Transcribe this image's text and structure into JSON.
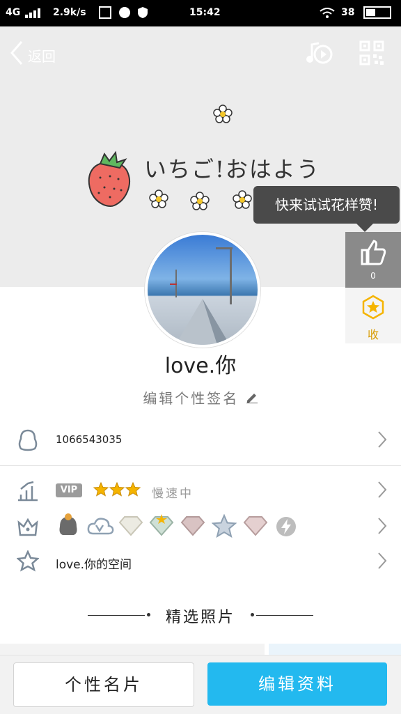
{
  "status_bar": {
    "network": "4G",
    "speed": "2.9k/s",
    "time": "15:42",
    "battery": "38"
  },
  "nav": {
    "back_label": "返回"
  },
  "banner": {
    "text": "いちご!おはよう"
  },
  "tooltip": {
    "text": "快来试试花样赞!"
  },
  "like": {
    "count": "0"
  },
  "collect": {
    "label": "收"
  },
  "profile": {
    "username": "love.你",
    "signature": "编辑个性签名"
  },
  "rows": {
    "qq_number": "1066543035",
    "vip_badge": "VIP",
    "vip_status": "慢速中",
    "space": "love.你的空间"
  },
  "featured": {
    "title": "精选照片"
  },
  "buttons": {
    "card": "个性名片",
    "edit": "编辑资料"
  },
  "colors": {
    "accent": "#23b9ef",
    "star": "#f5b400"
  }
}
